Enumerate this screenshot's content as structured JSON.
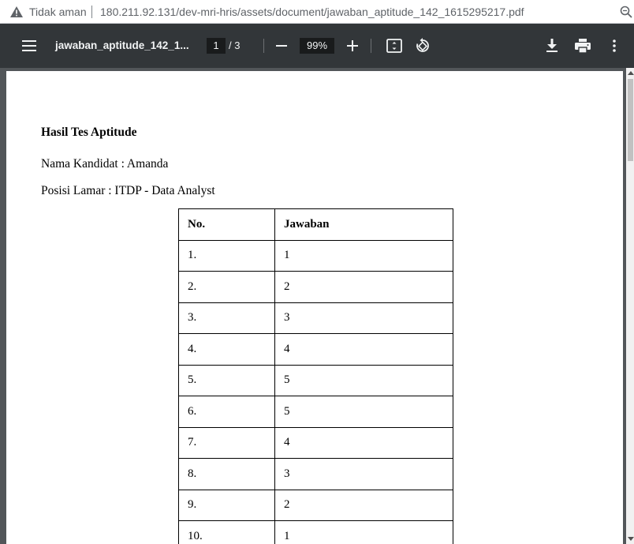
{
  "addressbar": {
    "security_label": "Tidak aman",
    "url": "180.211.92.131/dev-mri-hris/assets/document/jawaban_aptitude_142_1615295217.pdf",
    "warning_icon": "warning-triangle-icon",
    "zoom_icon": "magnifier-icon"
  },
  "toolbar": {
    "doc_title": "jawaban_aptitude_142_1...",
    "current_page": "1",
    "page_total": "/ 3",
    "zoom_level": "99%",
    "icons": [
      "menu-icon",
      "minus-icon",
      "plus-icon",
      "fit-page-icon",
      "rotate-icon",
      "download-icon",
      "print-icon",
      "more-vert-icon"
    ]
  },
  "document": {
    "heading": "Hasil Tes Aptitude",
    "candidate": "Nama Kandidat : Amanda",
    "position": "Posisi Lamar : ITDP - Data Analyst",
    "table": {
      "headers": [
        "No.",
        "Jawaban"
      ],
      "rows": [
        [
          "1.",
          "1"
        ],
        [
          "2.",
          "2"
        ],
        [
          "3.",
          "3"
        ],
        [
          "4.",
          "4"
        ],
        [
          "5.",
          "5"
        ],
        [
          "6.",
          "5"
        ],
        [
          "7.",
          "4"
        ],
        [
          "8.",
          "3"
        ],
        [
          "9.",
          "2"
        ],
        [
          "10.",
          "1"
        ]
      ]
    }
  },
  "colors": {
    "toolbar_bg": "#323639",
    "viewer_bg": "#525659",
    "page_bg": "#ffffff"
  }
}
